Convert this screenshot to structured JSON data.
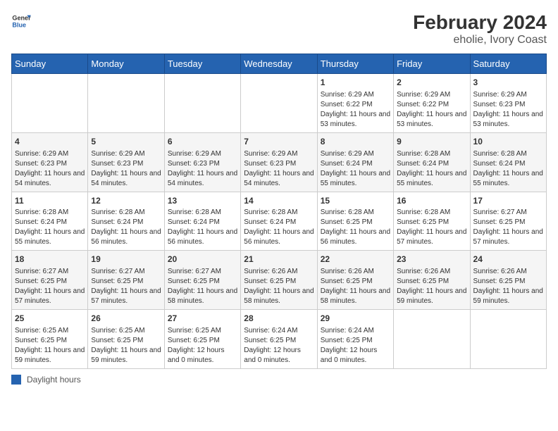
{
  "header": {
    "logo_line1": "General",
    "logo_line2": "Blue",
    "title": "February 2024",
    "subtitle": "eholie, Ivory Coast"
  },
  "days_of_week": [
    "Sunday",
    "Monday",
    "Tuesday",
    "Wednesday",
    "Thursday",
    "Friday",
    "Saturday"
  ],
  "weeks": [
    [
      {
        "day": "",
        "info": ""
      },
      {
        "day": "",
        "info": ""
      },
      {
        "day": "",
        "info": ""
      },
      {
        "day": "",
        "info": ""
      },
      {
        "day": "1",
        "info": "Sunrise: 6:29 AM\nSunset: 6:22 PM\nDaylight: 11 hours and 53 minutes."
      },
      {
        "day": "2",
        "info": "Sunrise: 6:29 AM\nSunset: 6:22 PM\nDaylight: 11 hours and 53 minutes."
      },
      {
        "day": "3",
        "info": "Sunrise: 6:29 AM\nSunset: 6:23 PM\nDaylight: 11 hours and 53 minutes."
      }
    ],
    [
      {
        "day": "4",
        "info": "Sunrise: 6:29 AM\nSunset: 6:23 PM\nDaylight: 11 hours and 54 minutes."
      },
      {
        "day": "5",
        "info": "Sunrise: 6:29 AM\nSunset: 6:23 PM\nDaylight: 11 hours and 54 minutes."
      },
      {
        "day": "6",
        "info": "Sunrise: 6:29 AM\nSunset: 6:23 PM\nDaylight: 11 hours and 54 minutes."
      },
      {
        "day": "7",
        "info": "Sunrise: 6:29 AM\nSunset: 6:23 PM\nDaylight: 11 hours and 54 minutes."
      },
      {
        "day": "8",
        "info": "Sunrise: 6:29 AM\nSunset: 6:24 PM\nDaylight: 11 hours and 55 minutes."
      },
      {
        "day": "9",
        "info": "Sunrise: 6:28 AM\nSunset: 6:24 PM\nDaylight: 11 hours and 55 minutes."
      },
      {
        "day": "10",
        "info": "Sunrise: 6:28 AM\nSunset: 6:24 PM\nDaylight: 11 hours and 55 minutes."
      }
    ],
    [
      {
        "day": "11",
        "info": "Sunrise: 6:28 AM\nSunset: 6:24 PM\nDaylight: 11 hours and 55 minutes."
      },
      {
        "day": "12",
        "info": "Sunrise: 6:28 AM\nSunset: 6:24 PM\nDaylight: 11 hours and 56 minutes."
      },
      {
        "day": "13",
        "info": "Sunrise: 6:28 AM\nSunset: 6:24 PM\nDaylight: 11 hours and 56 minutes."
      },
      {
        "day": "14",
        "info": "Sunrise: 6:28 AM\nSunset: 6:24 PM\nDaylight: 11 hours and 56 minutes."
      },
      {
        "day": "15",
        "info": "Sunrise: 6:28 AM\nSunset: 6:25 PM\nDaylight: 11 hours and 56 minutes."
      },
      {
        "day": "16",
        "info": "Sunrise: 6:28 AM\nSunset: 6:25 PM\nDaylight: 11 hours and 57 minutes."
      },
      {
        "day": "17",
        "info": "Sunrise: 6:27 AM\nSunset: 6:25 PM\nDaylight: 11 hours and 57 minutes."
      }
    ],
    [
      {
        "day": "18",
        "info": "Sunrise: 6:27 AM\nSunset: 6:25 PM\nDaylight: 11 hours and 57 minutes."
      },
      {
        "day": "19",
        "info": "Sunrise: 6:27 AM\nSunset: 6:25 PM\nDaylight: 11 hours and 57 minutes."
      },
      {
        "day": "20",
        "info": "Sunrise: 6:27 AM\nSunset: 6:25 PM\nDaylight: 11 hours and 58 minutes."
      },
      {
        "day": "21",
        "info": "Sunrise: 6:26 AM\nSunset: 6:25 PM\nDaylight: 11 hours and 58 minutes."
      },
      {
        "day": "22",
        "info": "Sunrise: 6:26 AM\nSunset: 6:25 PM\nDaylight: 11 hours and 58 minutes."
      },
      {
        "day": "23",
        "info": "Sunrise: 6:26 AM\nSunset: 6:25 PM\nDaylight: 11 hours and 59 minutes."
      },
      {
        "day": "24",
        "info": "Sunrise: 6:26 AM\nSunset: 6:25 PM\nDaylight: 11 hours and 59 minutes."
      }
    ],
    [
      {
        "day": "25",
        "info": "Sunrise: 6:25 AM\nSunset: 6:25 PM\nDaylight: 11 hours and 59 minutes."
      },
      {
        "day": "26",
        "info": "Sunrise: 6:25 AM\nSunset: 6:25 PM\nDaylight: 11 hours and 59 minutes."
      },
      {
        "day": "27",
        "info": "Sunrise: 6:25 AM\nSunset: 6:25 PM\nDaylight: 12 hours and 0 minutes."
      },
      {
        "day": "28",
        "info": "Sunrise: 6:24 AM\nSunset: 6:25 PM\nDaylight: 12 hours and 0 minutes."
      },
      {
        "day": "29",
        "info": "Sunrise: 6:24 AM\nSunset: 6:25 PM\nDaylight: 12 hours and 0 minutes."
      },
      {
        "day": "",
        "info": ""
      },
      {
        "day": "",
        "info": ""
      }
    ]
  ],
  "footer": {
    "legend_label": "Daylight hours"
  }
}
